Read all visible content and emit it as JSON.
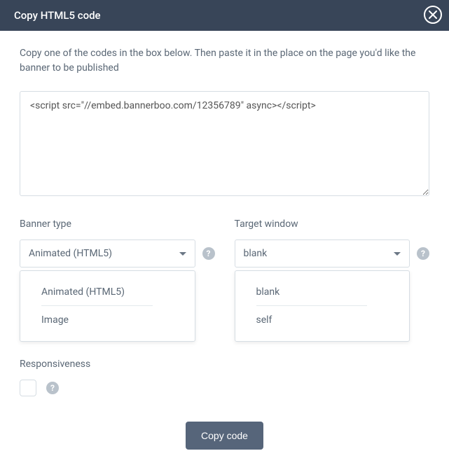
{
  "header": {
    "title": "Copy HTML5 code"
  },
  "description": "Copy one of the codes in the box below. Then paste it in the place on the page you'd like the banner to be published",
  "code": "<script src=\"//embed.bannerboo.com/12356789\" async></script>",
  "bannerType": {
    "label": "Banner type",
    "selected": "Animated (HTML5)",
    "options": [
      "Animated (HTML5)",
      "Image"
    ]
  },
  "targetWindow": {
    "label": "Target window",
    "selected": "blank",
    "options": [
      "blank",
      "self"
    ]
  },
  "responsiveness": {
    "label": "Responsiveness"
  },
  "footer": {
    "copyButton": "Copy code"
  }
}
